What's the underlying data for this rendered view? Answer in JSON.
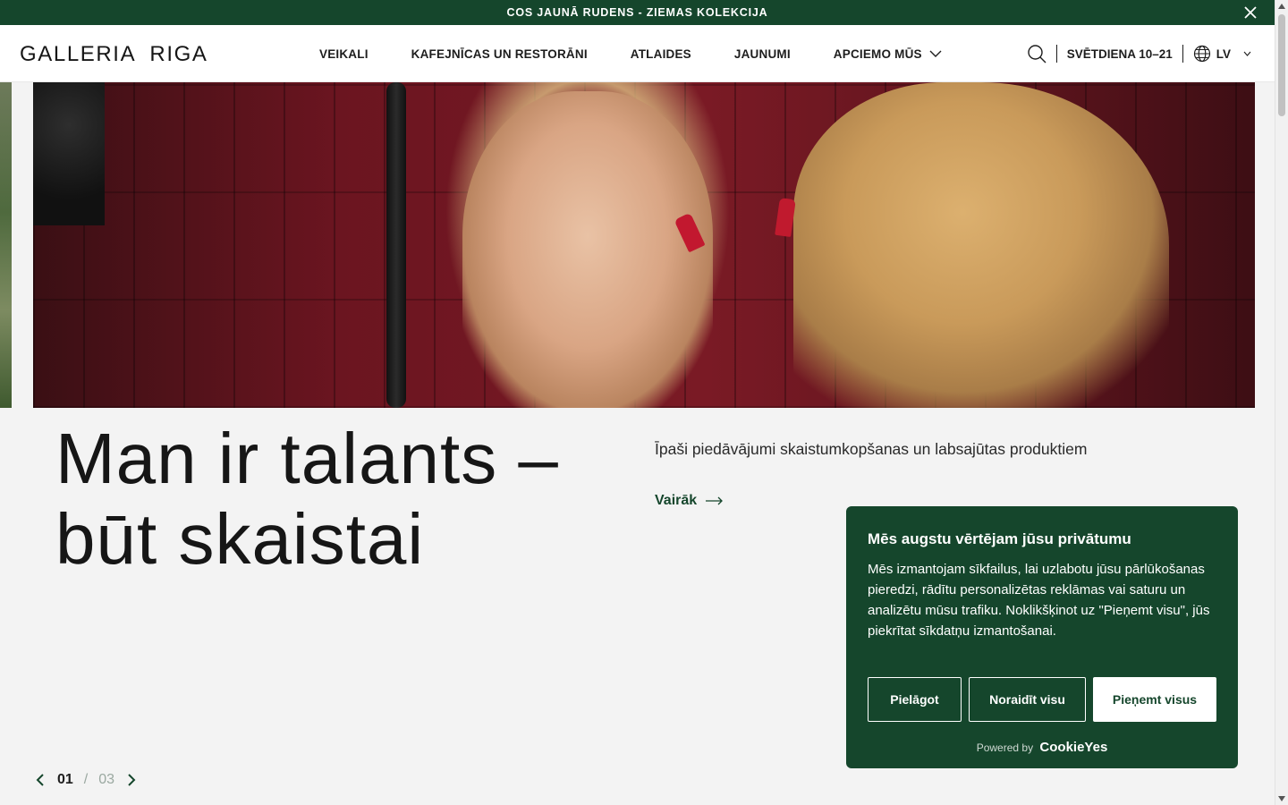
{
  "announcement": {
    "text": "COS JAUNĀ RUDENS - ZIEMAS KOLEKCIJA",
    "close_icon": "close-icon"
  },
  "header": {
    "logo": "GALLERIA  RIGA",
    "nav": [
      {
        "label": "VEIKALI"
      },
      {
        "label": "KAFEJNĪCAS UN RESTORĀNI"
      },
      {
        "label": "ATLAIDES"
      },
      {
        "label": "JAUNUMI"
      },
      {
        "label": "APCIEMO MŪS"
      }
    ],
    "hours": "SVĒTDIENA 10–21",
    "language": "LV"
  },
  "hero": {
    "title": "Man ir talants – būt skaistai",
    "subtitle": "Īpaši piedāvājumi skaistumkopšanas un labsajūtas produktiem",
    "more_link": "Vairāk"
  },
  "pager": {
    "current": "01",
    "separator": "/",
    "total": "03"
  },
  "cookie": {
    "title": "Mēs augstu vērtējam jūsu privātumu",
    "body": "Mēs izmantojam sīkfailus, lai uzlabotu jūsu pārlūkošanas pieredzi, rādītu personalizētas reklāmas vai saturu un analizētu mūsu trafiku. Noklikšķinot uz \"Pieņemt visu\", jūs piekrītat sīkdatņu izmantošanai.",
    "customize": "Pielāgot",
    "reject": "Noraidīt visu",
    "accept": "Pieņemt visus",
    "powered_by": "Powered by",
    "brand": "CookieYes"
  },
  "colors": {
    "brand_green": "#15462c",
    "background": "#f3f3f3"
  }
}
